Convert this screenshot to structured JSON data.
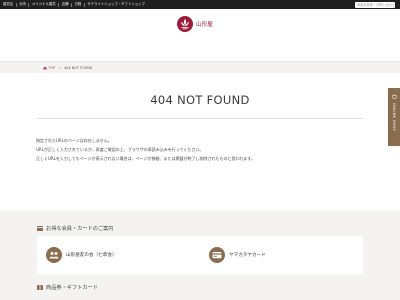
{
  "topnav": {
    "items": [
      "雑貨店",
      "お肉",
      "オリジナル雑貨",
      "店舗",
      "日程",
      "サテライトショップ・ギフトショップ"
    ]
  },
  "search": {
    "placeholder": "商品を検索・お問い合わせ"
  },
  "logo": {
    "text": "山形屋"
  },
  "breadcrumb": {
    "home": "TOP",
    "separator": ">",
    "current": "404 NOT FOUND"
  },
  "page_title": "404 NOT FOUND",
  "messages": [
    "指定されたURLのページは存在しません。",
    "URLが正しく入力されているか、再度ご確認の上、ブラウザの再読み込みを行ってください。",
    "正しくURLを入力してもページが表示されない場合は、ページが移動、または掲載が終了し削除されたものと思われます。"
  ],
  "side_tab": {
    "label": "ONLINE SHOP"
  },
  "sections": {
    "members": {
      "title": "お得な会員・カードのご案内",
      "cards": [
        "山形屋友の会（七草会）",
        "ヤマカタヤカード"
      ]
    },
    "gifts": {
      "title": "商品券・ギフトカード"
    }
  },
  "colors": {
    "brand": "#9e1a3a",
    "accent": "#8a6d4f",
    "topbar": "#1f1f1f",
    "muted_bg": "#f4f3f1"
  }
}
